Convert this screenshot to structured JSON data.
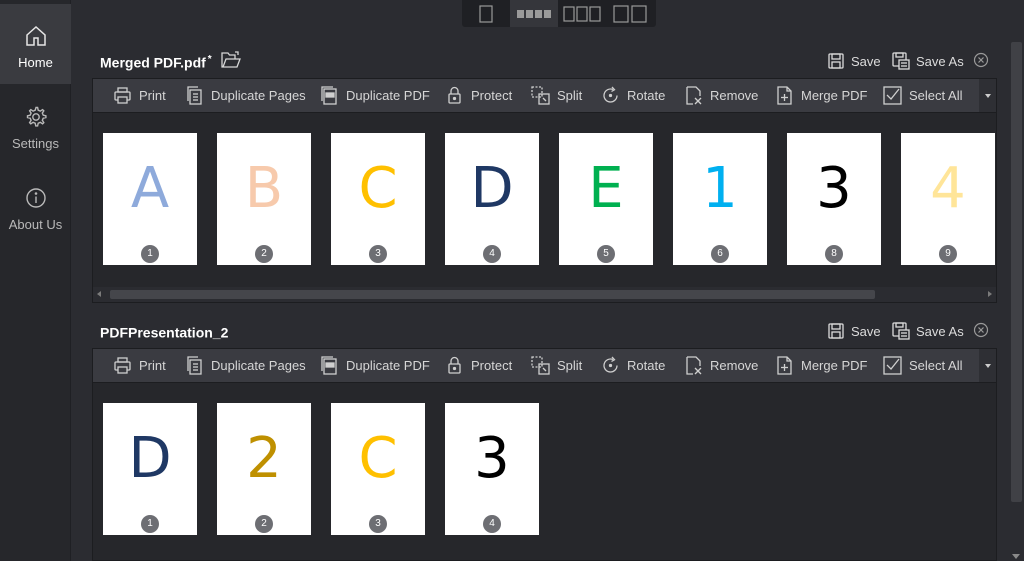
{
  "sidebar": {
    "items": [
      {
        "label": "Home",
        "icon": "home-icon",
        "active": true
      },
      {
        "label": "Settings",
        "icon": "gear-icon",
        "active": false
      },
      {
        "label": "About Us",
        "icon": "info-icon",
        "active": false
      }
    ]
  },
  "view_toggle": {
    "options": [
      "single-page-view",
      "grid-view",
      "three-page-view",
      "two-page-view"
    ],
    "active": "grid-view"
  },
  "toolbar_labels": {
    "print": "Print",
    "duplicate_pages": "Duplicate Pages",
    "duplicate_pdf": "Duplicate PDF",
    "protect": "Protect",
    "split": "Split",
    "rotate": "Rotate",
    "remove": "Remove",
    "merge_pdf": "Merge PDF",
    "select_all": "Select All"
  },
  "documents": [
    {
      "title": "Merged PDF.pdf",
      "modified_mark": "*",
      "save_label": "Save",
      "save_as_label": "Save As",
      "pages": [
        {
          "glyph": "A",
          "color": "#8eaadb",
          "number": "1"
        },
        {
          "glyph": "B",
          "color": "#f7caac",
          "number": "2"
        },
        {
          "glyph": "C",
          "color": "#ffc000",
          "number": "3"
        },
        {
          "glyph": "D",
          "color": "#1f3864",
          "number": "4"
        },
        {
          "glyph": "E",
          "color": "#00b050",
          "number": "5"
        },
        {
          "glyph": "1",
          "color": "#00b0f0",
          "number": "6"
        },
        {
          "glyph": "3",
          "color": "#000000",
          "number": "8"
        },
        {
          "glyph": "4",
          "color": "#ffe599",
          "number": "9"
        }
      ]
    },
    {
      "title": "PDFPresentation_2",
      "modified_mark": "",
      "save_label": "Save",
      "save_as_label": "Save As",
      "pages": [
        {
          "glyph": "D",
          "color": "#1f3864",
          "number": "1"
        },
        {
          "glyph": "2",
          "color": "#bf9000",
          "number": "2"
        },
        {
          "glyph": "C",
          "color": "#ffc000",
          "number": "3"
        },
        {
          "glyph": "3",
          "color": "#000000",
          "number": "4"
        }
      ]
    }
  ],
  "colors": {
    "background": "#2b2c31",
    "toolbar": "#3a3b41",
    "pages_area": "#26272b",
    "page_badge": "#6d6e73"
  }
}
